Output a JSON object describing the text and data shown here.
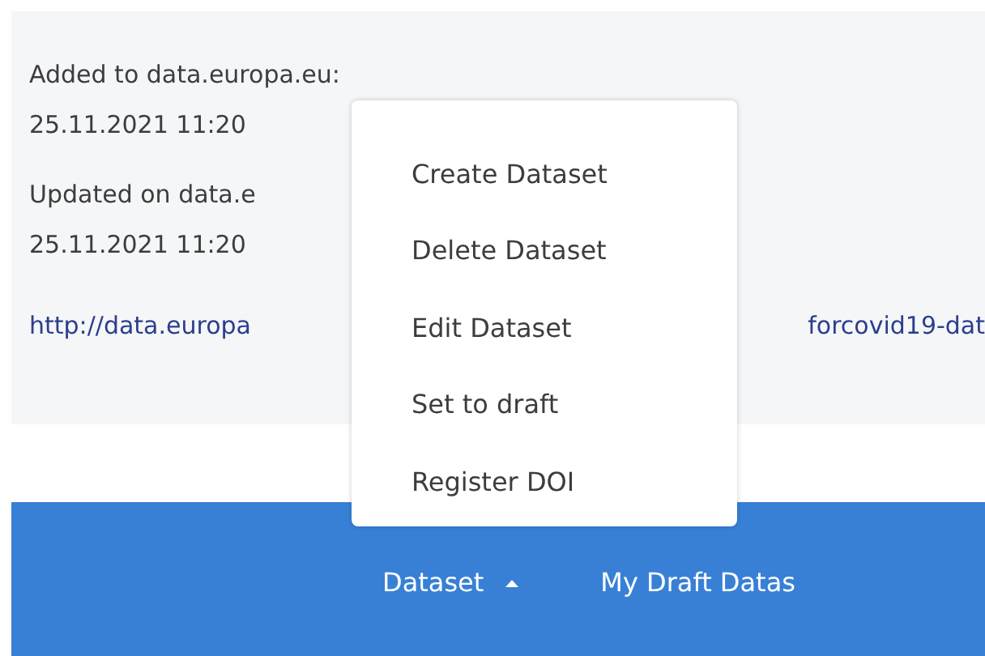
{
  "info": {
    "added_label": "Added to data.europa.eu:",
    "added_date": "25.11.2021 11:20",
    "updated_label": "Updated on data.e",
    "updated_date": "25.11.2021 11:20",
    "link_start": "http://data.europa",
    "link_end": "forcovid19-dat"
  },
  "dropdown": {
    "items": [
      {
        "label": "Create Dataset"
      },
      {
        "label": "Delete Dataset"
      },
      {
        "label": "Edit Dataset"
      },
      {
        "label": "Set to draft"
      },
      {
        "label": "Register DOI"
      }
    ]
  },
  "navbar": {
    "items": [
      {
        "label": "Dataset",
        "expanded": true
      },
      {
        "label": "My Draft Datas",
        "expanded": false
      }
    ]
  }
}
